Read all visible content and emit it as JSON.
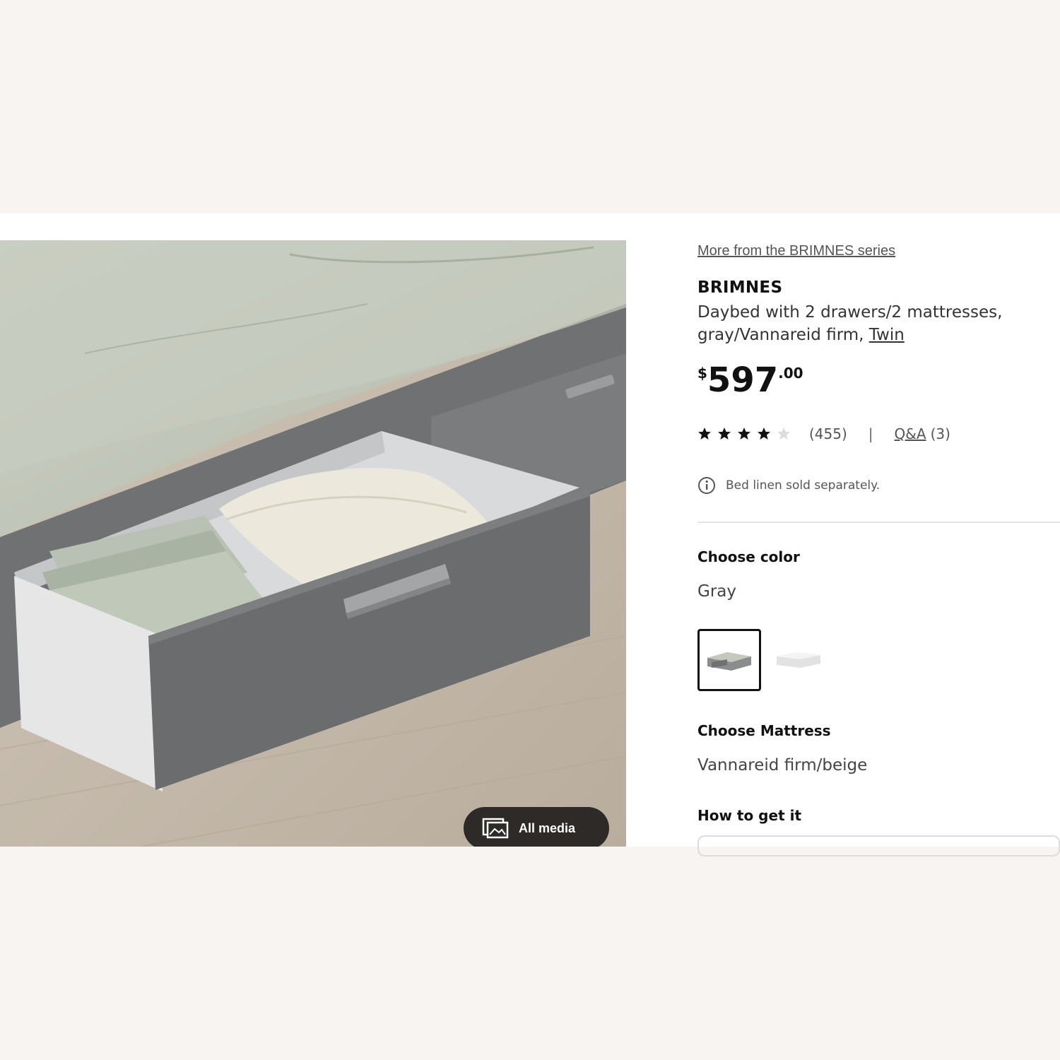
{
  "media": {
    "all_media_label": "All media",
    "image_icon": "image-gallery-icon"
  },
  "product": {
    "series_link": "More from the BRIMNES series",
    "name": "BRIMNES",
    "description": "Daybed with 2 drawers/2 mattresses, gray/Vannareid firm,",
    "size_link": "Twin",
    "price": {
      "currency": "$",
      "integer": "597",
      "decimal": ".00"
    },
    "rating": {
      "stars": 4,
      "max": 5,
      "count": "(455)"
    },
    "separator": "|",
    "qa": {
      "label": "Q&A",
      "count": "(3)"
    },
    "note": {
      "icon": "info-icon",
      "text": "Bed linen sold separately."
    }
  },
  "options": {
    "color": {
      "label": "Choose color",
      "value": "Gray",
      "swatches": [
        {
          "name": "gray",
          "selected": true
        },
        {
          "name": "white",
          "selected": false
        }
      ]
    },
    "mattress": {
      "label": "Choose Mattress",
      "value": "Vannareid firm/beige"
    },
    "delivery": {
      "label": "How to get it"
    }
  },
  "colors": {
    "background": "#f7f4f1",
    "panel": "#ffffff",
    "button_dark": "#2e2a28",
    "text_primary": "#111111",
    "text_secondary": "#555555"
  }
}
